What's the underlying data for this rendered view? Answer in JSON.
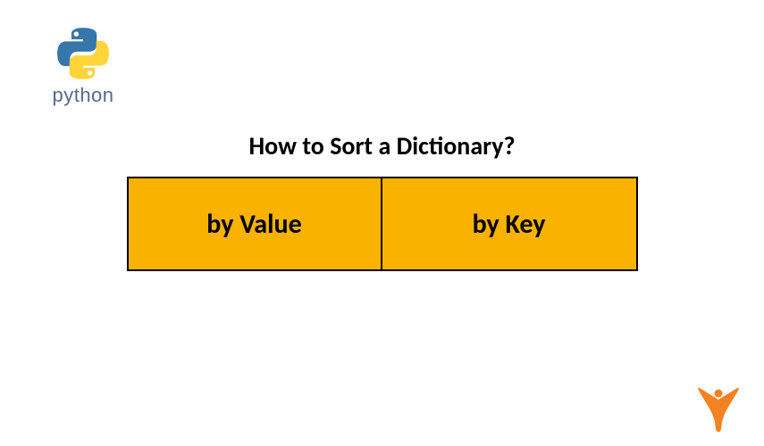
{
  "logo": {
    "label": "python",
    "icon_name": "python-logo-icon"
  },
  "title": "How to Sort a Dictionary?",
  "options": {
    "left": "by Value",
    "right": "by Key"
  },
  "colors": {
    "cell_bg": "#f9b200",
    "python_text": "#57698f",
    "corner_logo": "#f58220"
  },
  "corner": {
    "icon_name": "person-logo-icon"
  }
}
